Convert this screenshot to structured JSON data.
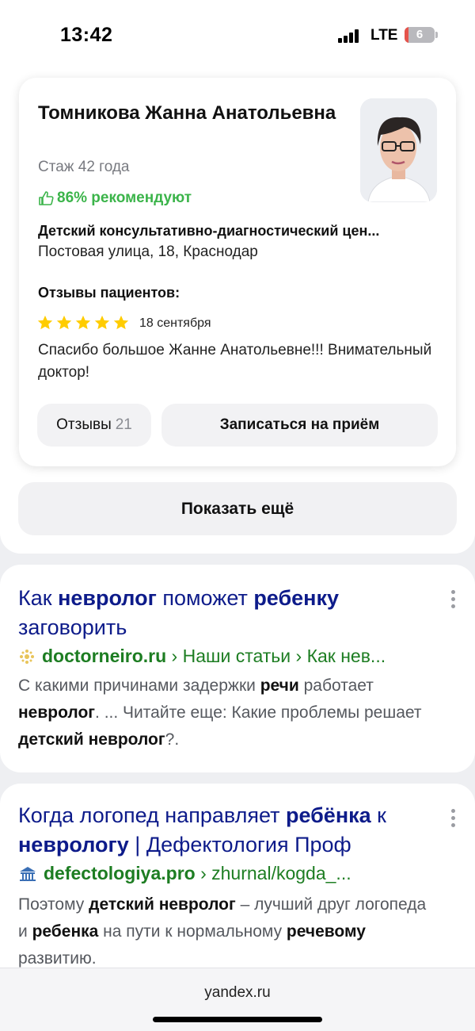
{
  "status_bar": {
    "time": "13:42",
    "network": "LTE",
    "battery": "6",
    "icons": [
      "signal-icon",
      "battery-icon"
    ]
  },
  "doctor_card": {
    "name": "Томникова Жанна Анатольевна",
    "experience": "Стаж 42 года",
    "recommend": "86% рекомендуют",
    "recommend_icon": "thumbs-up-icon",
    "clinic": "Детский консультативно-диагностический цен...",
    "address": "Постовая улица, 18, Краснодар",
    "reviews_title": "Отзывы пациентов:",
    "rating": 5,
    "rating_max": 5,
    "review_date": "18 сентября",
    "review_text": "Спасибо большое Жанне Анатольевне!!! Внимательный доктор!",
    "reviews_button": "Отзывы",
    "reviews_count": "21",
    "book_button": "Записаться на приём",
    "colors": {
      "recommend": "#3bb44a",
      "star": "#ffcc00"
    }
  },
  "show_more": "Показать ещё",
  "results": [
    {
      "title_parts": [
        {
          "text": "Как ",
          "bold": false
        },
        {
          "text": "невролог",
          "bold": true
        },
        {
          "text": " поможет ",
          "bold": false
        },
        {
          "text": "ребенку",
          "bold": true
        },
        {
          "text": " заговорить",
          "bold": false
        }
      ],
      "favicon": "doctorneiro-favicon-icon",
      "domain": "doctorneiro.ru",
      "path": " › Наши статьи › Как нев...",
      "snippet_parts": [
        {
          "text": "С какими причинами задержки ",
          "bold": false
        },
        {
          "text": "речи",
          "bold": true
        },
        {
          "text": " работает ",
          "bold": false
        },
        {
          "text": "невролог",
          "bold": true
        },
        {
          "text": ". ... Читайте еще: Какие проблемы решает ",
          "bold": false
        },
        {
          "text": "детский невролог",
          "bold": true
        },
        {
          "text": "?.",
          "bold": false
        }
      ]
    },
    {
      "title_parts": [
        {
          "text": "Когда логопед направляет ",
          "bold": false
        },
        {
          "text": "ребёнка",
          "bold": true
        },
        {
          "text": " к ",
          "bold": false
        },
        {
          "text": "неврологу",
          "bold": true
        },
        {
          "text": " | Дефектология Проф",
          "bold": false
        }
      ],
      "favicon": "defectologiya-favicon-icon",
      "domain": "defectologiya.pro",
      "path": " › zhurnal/kogda_...",
      "snippet_parts": [
        {
          "text": "Поэтому ",
          "bold": false
        },
        {
          "text": "детский невролог",
          "bold": true
        },
        {
          "text": " – лучший друг логопеда и ",
          "bold": false
        },
        {
          "text": "ребенка",
          "bold": true
        },
        {
          "text": " на пути к нормальному ",
          "bold": false
        },
        {
          "text": "речевому",
          "bold": true
        },
        {
          "text": " развитию.",
          "bold": false
        }
      ]
    }
  ],
  "bottom_bar": {
    "address": "yandex.ru"
  }
}
